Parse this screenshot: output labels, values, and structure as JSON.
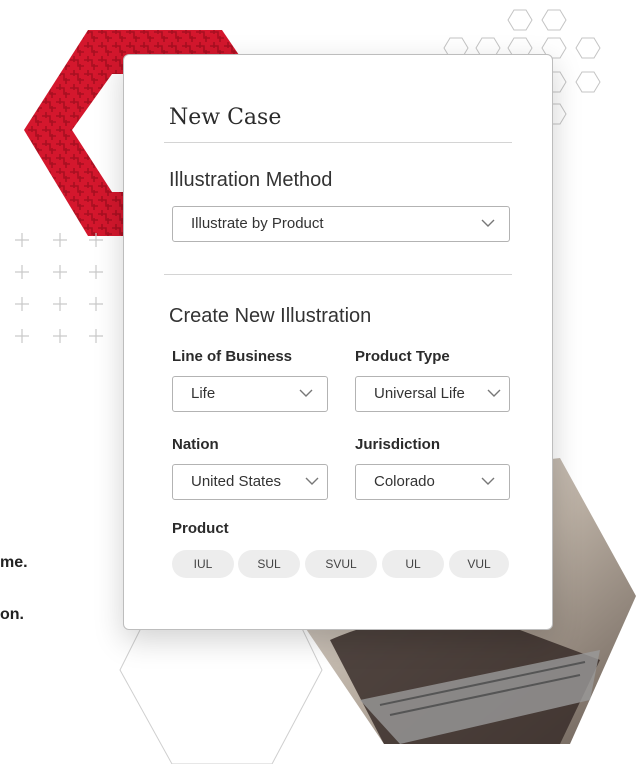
{
  "side_text": {
    "line1": "me.",
    "line2": "on."
  },
  "card": {
    "title": "New Case",
    "illustration_method": {
      "heading": "Illustration Method",
      "selected": "Illustrate by Product"
    },
    "create_section": {
      "heading": "Create New Illustration",
      "line_of_business": {
        "label": "Line of Business",
        "selected": "Life"
      },
      "product_type": {
        "label": "Product Type",
        "selected": "Universal Life"
      },
      "nation": {
        "label": "Nation",
        "selected": "United States"
      },
      "jurisdiction": {
        "label": "Jurisdiction",
        "selected": "Colorado"
      },
      "product": {
        "label": "Product",
        "chips": [
          "IUL",
          "SUL",
          "SVUL",
          "UL",
          "VUL"
        ]
      }
    }
  },
  "colors": {
    "brand_red": "#d4172d",
    "border": "#b3b3b3",
    "chip_bg": "#ededed"
  }
}
